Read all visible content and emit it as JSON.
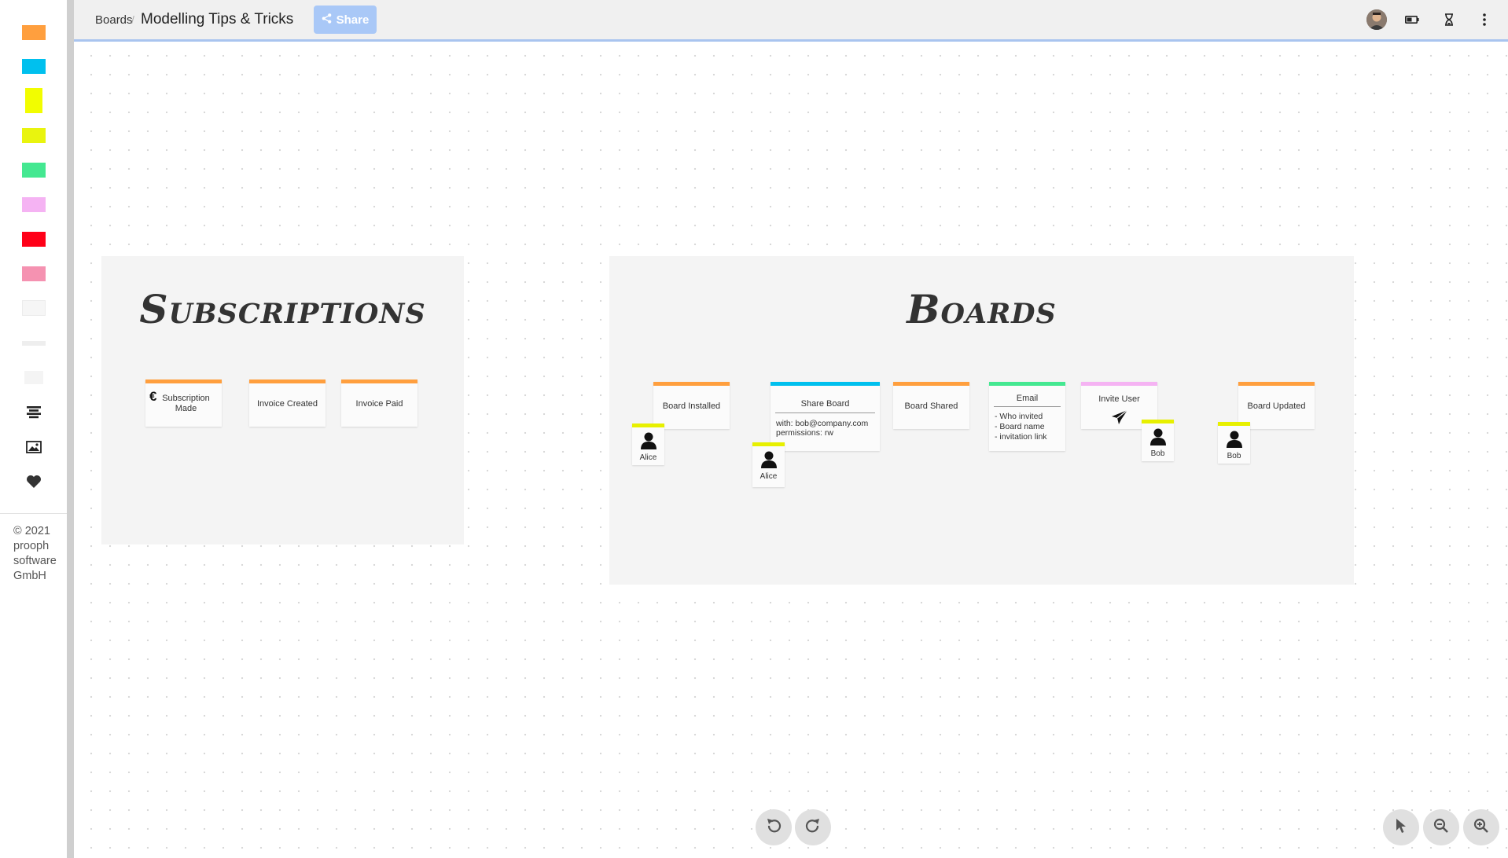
{
  "header": {
    "breadcrumb_root": "Boards",
    "separator": "/",
    "board_title": "Modelling Tips & Tricks",
    "share_label": "Share",
    "icons": [
      "avatar",
      "battery-icon",
      "hourglass-icon",
      "more-vertical-icon"
    ]
  },
  "sidebar": {
    "swatches": [
      {
        "name": "orange",
        "color": "#ff9f3e"
      },
      {
        "name": "blue",
        "color": "#00c0ee"
      },
      {
        "name": "yellow-tall",
        "color": "#f2fd00"
      },
      {
        "name": "yellow",
        "color": "#e9f40e"
      },
      {
        "name": "green",
        "color": "#44e891"
      },
      {
        "name": "pink",
        "color": "#f5b3f3"
      },
      {
        "name": "red",
        "color": "#ff0018"
      },
      {
        "name": "rose",
        "color": "#f592b1"
      },
      {
        "name": "white-card",
        "color": "#f6f6f6"
      },
      {
        "name": "line",
        "color": "#eeeeee"
      },
      {
        "name": "white-small",
        "color": "#f4f4f4"
      }
    ],
    "tools": [
      "text-align-icon",
      "image-icon",
      "heart-icon"
    ],
    "copyright": "© 2021 prooph software GmbH"
  },
  "frames": {
    "subscriptions": {
      "title": "Subscriptions"
    },
    "boards": {
      "title": "Boards"
    }
  },
  "stickies": {
    "subscription_made": {
      "currency_symbol": "€",
      "label": "Subscription Made"
    },
    "invoice_created": {
      "label": "Invoice Created"
    },
    "invoice_paid": {
      "label": "Invoice Paid"
    },
    "board_installed": {
      "label": "Board Installed"
    },
    "share_board": {
      "label": "Share Board",
      "with": "with:  bob@company.com",
      "permissions": "permissions: rw"
    },
    "board_shared": {
      "label": "Board Shared"
    },
    "email": {
      "label": "Email",
      "lines": [
        "- Who invited",
        "- Board name",
        "- invitation link"
      ]
    },
    "invite_user": {
      "label": "Invite User"
    },
    "board_updated": {
      "label": "Board Updated"
    },
    "actor_alice_1": {
      "name": "Alice"
    },
    "actor_alice_2": {
      "name": "Alice"
    },
    "actor_bob_1": {
      "name": "Bob"
    },
    "actor_bob_2": {
      "name": "Bob"
    }
  },
  "colors": {
    "event": "#ff9f3e",
    "command": "#00c0ee",
    "readmodel": "#44e891",
    "ui": "#f5b3f3",
    "actor": "#e7f000",
    "accent": "#a9c8f7"
  },
  "controls": {
    "history": [
      "undo-icon",
      "redo-icon"
    ],
    "view": [
      "pointer-icon",
      "zoom-out-icon",
      "zoom-in-icon"
    ]
  }
}
